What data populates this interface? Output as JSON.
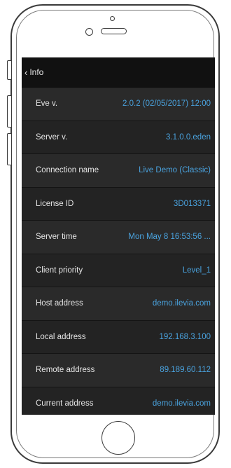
{
  "navbar": {
    "back_label": "Info",
    "back_icon": "chevron-left-icon"
  },
  "rows": [
    {
      "label": "Eve v.",
      "value": "2.0.2 (02/05/2017) 12:00"
    },
    {
      "label": "Server v.",
      "value": "3.1.0.0.eden"
    },
    {
      "label": "Connection name",
      "value": "Live Demo (Classic)"
    },
    {
      "label": "License ID",
      "value": "3D013371"
    },
    {
      "label": "Server time",
      "value": "Mon May  8 16:53:56 ..."
    },
    {
      "label": "Client priority",
      "value": "Level_1"
    },
    {
      "label": "Host address",
      "value": "demo.ilevia.com"
    },
    {
      "label": "Local address",
      "value": "192.168.3.100"
    },
    {
      "label": "Remote address",
      "value": "89.189.60.112"
    },
    {
      "label": "Current address",
      "value": "demo.ilevia.com"
    }
  ],
  "colors": {
    "accent": "#4aa3df",
    "background": "#1e1e1e",
    "navbar": "#111111"
  }
}
